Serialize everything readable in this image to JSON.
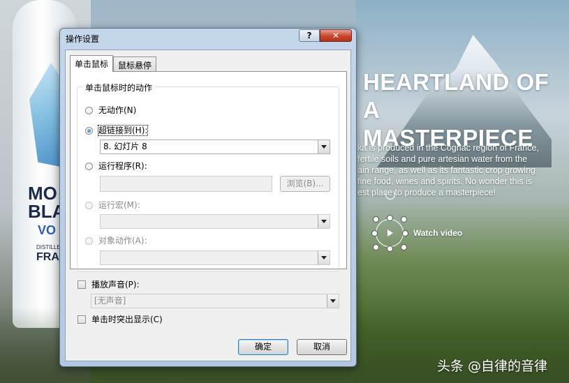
{
  "background": {
    "bottle_lines": [
      "MO",
      "BLA",
      "VO",
      "DISTILLED A",
      "FRA"
    ],
    "hero_title_lines": [
      "HEARTLAND OF A",
      "MASTERPIECE"
    ],
    "hero_body_lines": [
      "ka is produced in the Cognac region of France,",
      "fertile soils and pure artesian water from the",
      "ain range, as well as its fantastic crop growing",
      "fine food, wines and spirits. No wonder this is",
      "est place to produce a masterpiece!"
    ],
    "watch_video_label": "Watch video"
  },
  "watermark": "头条 @自律的音律",
  "dialog": {
    "title": "操作设置",
    "help_label": "?",
    "close_label": "✕",
    "tabs": [
      {
        "label": "单击鼠标",
        "active": true
      },
      {
        "label": "鼠标悬停",
        "active": false
      }
    ],
    "group_title": "单击鼠标时的动作",
    "options": {
      "none": "无动作(N)",
      "hyperlink": "超链接到(H):",
      "hyperlink_value": "8. 幻灯片 8",
      "run_program": "运行程序(R):",
      "browse_label": "浏览(B)...",
      "run_macro": "运行宏(M):",
      "object_action": "对象动作(A):"
    },
    "play_sound_label": "播放声音(P):",
    "sound_value": "[无声音]",
    "highlight_label": "单击时突出显示(C)",
    "ok_label": "确定",
    "cancel_label": "取消",
    "selected_option": "hyperlink"
  }
}
